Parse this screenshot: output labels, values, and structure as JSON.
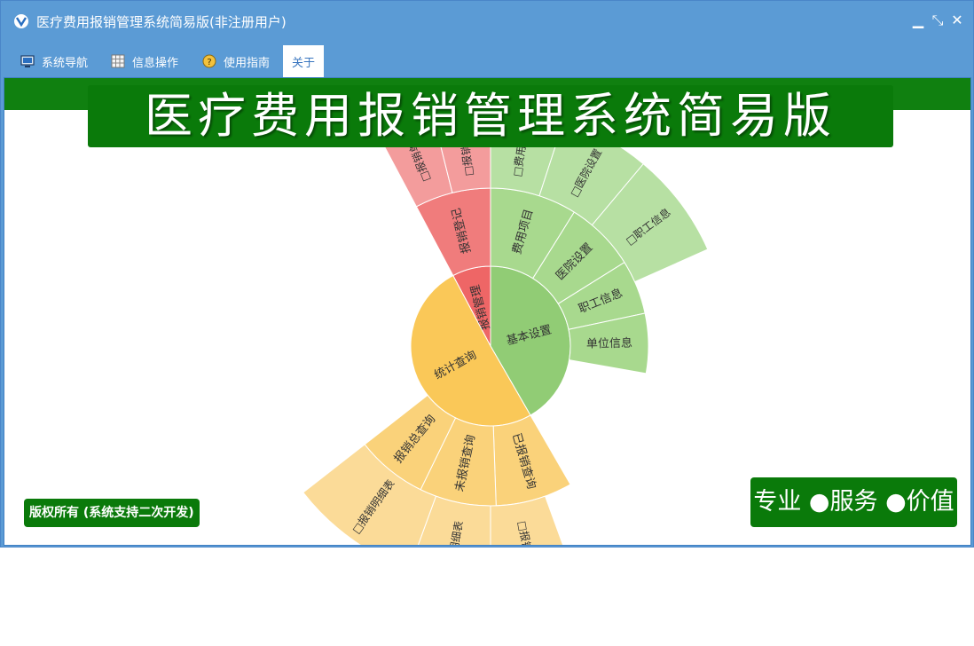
{
  "window": {
    "title": "医疗费用报销管理系统简易版(非注册用户)",
    "buttons": {
      "minimize": "▁",
      "restore": "⤡",
      "close": "✕"
    }
  },
  "menu": {
    "items": [
      {
        "label": "系统导航",
        "icon": "monitor-icon"
      },
      {
        "label": "信息操作",
        "icon": "grid-icon"
      },
      {
        "label": "使用指南",
        "icon": "help-icon"
      },
      {
        "label": "关于",
        "icon": ""
      }
    ]
  },
  "banner": {
    "title": "医疗费用报销管理系统简易版"
  },
  "footer": {
    "copyright": "版权所有 (系统支持二次开发)",
    "slogan": "专业 ●服务 ●价值"
  },
  "colors": {
    "titlebar": "#5b9bd5",
    "banner_green": "#0a7a0a",
    "red": "#ee6666",
    "red_mid": "#f07c7c",
    "red_light": "#f39c9c",
    "green": "#91cc75",
    "green_mid": "#a8d98e",
    "green_light": "#b7e0a3",
    "yellow": "#fac858",
    "yellow_mid": "#fad27a",
    "yellow_light": "#fbdb98"
  },
  "sunburst": {
    "inner": [
      {
        "label": "报销管理",
        "color": "#ee6666"
      },
      {
        "label": "基本设置",
        "color": "#91cc75"
      },
      {
        "label": "统计查询",
        "color": "#fac858"
      }
    ],
    "middle": [
      {
        "label": "报销登记",
        "color": "#f07c7c"
      },
      {
        "label": "费用项目",
        "color": "#a8d98e"
      },
      {
        "label": "医院设置",
        "color": "#a8d98e"
      },
      {
        "label": "职工信息",
        "color": "#a8d98e"
      },
      {
        "label": "单位信息",
        "color": "#a8d98e"
      },
      {
        "label": "已报销查询",
        "color": "#fad27a"
      },
      {
        "label": "未报销查询",
        "color": "#fad27a"
      },
      {
        "label": "报销总查询",
        "color": "#fad27a"
      }
    ],
    "outer": [
      {
        "label": "□报销单",
        "color": "#f39c9c"
      },
      {
        "label": "□报销登记",
        "color": "#f39c9c"
      },
      {
        "label": "□费用项目",
        "color": "#b7e0a3"
      },
      {
        "label": "□医院设置",
        "color": "#b7e0a3"
      },
      {
        "label": "□职工信息",
        "color": "#b7e0a3"
      },
      {
        "label": "□报销单",
        "color": "#fbdb98"
      },
      {
        "label": "□明细表",
        "color": "#fbdb98"
      },
      {
        "label": "□报销明细表",
        "color": "#fbdb98"
      }
    ]
  }
}
